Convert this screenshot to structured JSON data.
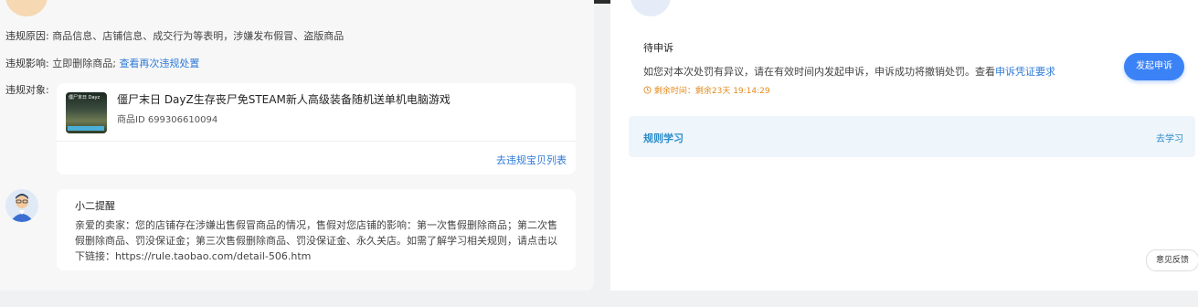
{
  "violation": {
    "reason_label": "违规原因:",
    "reason_value": "商品信息、店铺信息、成交行为等表明，涉嫌发布假冒、盗版商品",
    "impact_label": "违规影响:",
    "impact_value": "立即删除商品;",
    "impact_link": "查看再次违规处置",
    "object_label": "违规对象:"
  },
  "product": {
    "thumb_text": "僵尸末日 Dayz",
    "title": "僵尸末日 DayZ生存丧尸免STEAM新人高级装备随机送单机电脑游戏",
    "id_text": "商品ID 699306610094",
    "list_link": "去违规宝贝列表"
  },
  "message": {
    "title": "小二提醒",
    "body": "亲爱的卖家：您的店铺存在涉嫌出售假冒商品的情况，售假对您店铺的影响：第一次售假删除商品；第二次售假删除商品、罚没保证金；第三次售假删除商品、罚没保证金、永久关店。如需了解学习相关规则，请点击以下链接：https://rule.taobao.com/detail-506.htm"
  },
  "appeal": {
    "title": "待申诉",
    "desc": "如您对本次处罚有异议，请在有效时间内发起申诉，申诉成功将撤销处罚。查看",
    "desc_link": "申诉凭证要求",
    "time_text": "剩余时间：剩余23天 19:14:29",
    "button": "发起申诉"
  },
  "rules": {
    "title": "规则学习",
    "link": "去学习"
  },
  "feedback": "意见反馈",
  "colors": {
    "accent": "#3b82f6",
    "link": "#2f7bd9",
    "warning": "#e38a18",
    "rules_bg": "#eef5fb"
  }
}
